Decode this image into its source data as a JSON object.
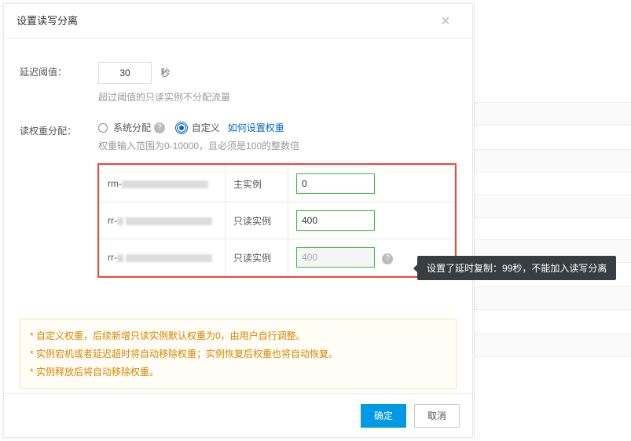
{
  "dialog": {
    "title": "设置读写分离",
    "threshold_label": "延迟阈值：",
    "threshold_value": "30",
    "threshold_unit": "秒",
    "threshold_hint": "超过阈值的只读实例不分配流量",
    "weight_label": "读权重分配：",
    "radio_system": "系统分配",
    "radio_custom": "自定义",
    "weight_link": "如何设置权重",
    "weight_hint": "权重输入范围为0-10000，且必须是100的整数倍",
    "rows": [
      {
        "id_prefix": "rm-",
        "type": "主实例",
        "value": "0",
        "disabled": false
      },
      {
        "id_prefix": "rr-",
        "type": "只读实例",
        "value": "400",
        "disabled": false
      },
      {
        "id_prefix": "rr-",
        "type": "只读实例",
        "value": "400",
        "disabled": true
      }
    ],
    "tooltip": "设置了延时复制：99秒，不能加入读写分离",
    "notices": [
      "* 自定义权重，后续新增只读实例默认权重为0，由用户自行调整。",
      "* 实例宕机或者延迟超时将自动移除权重；实例恢复后权重也将自动恢复。",
      "* 实例释放后将自动移除权重。"
    ],
    "ok": "确定",
    "cancel": "取消"
  }
}
